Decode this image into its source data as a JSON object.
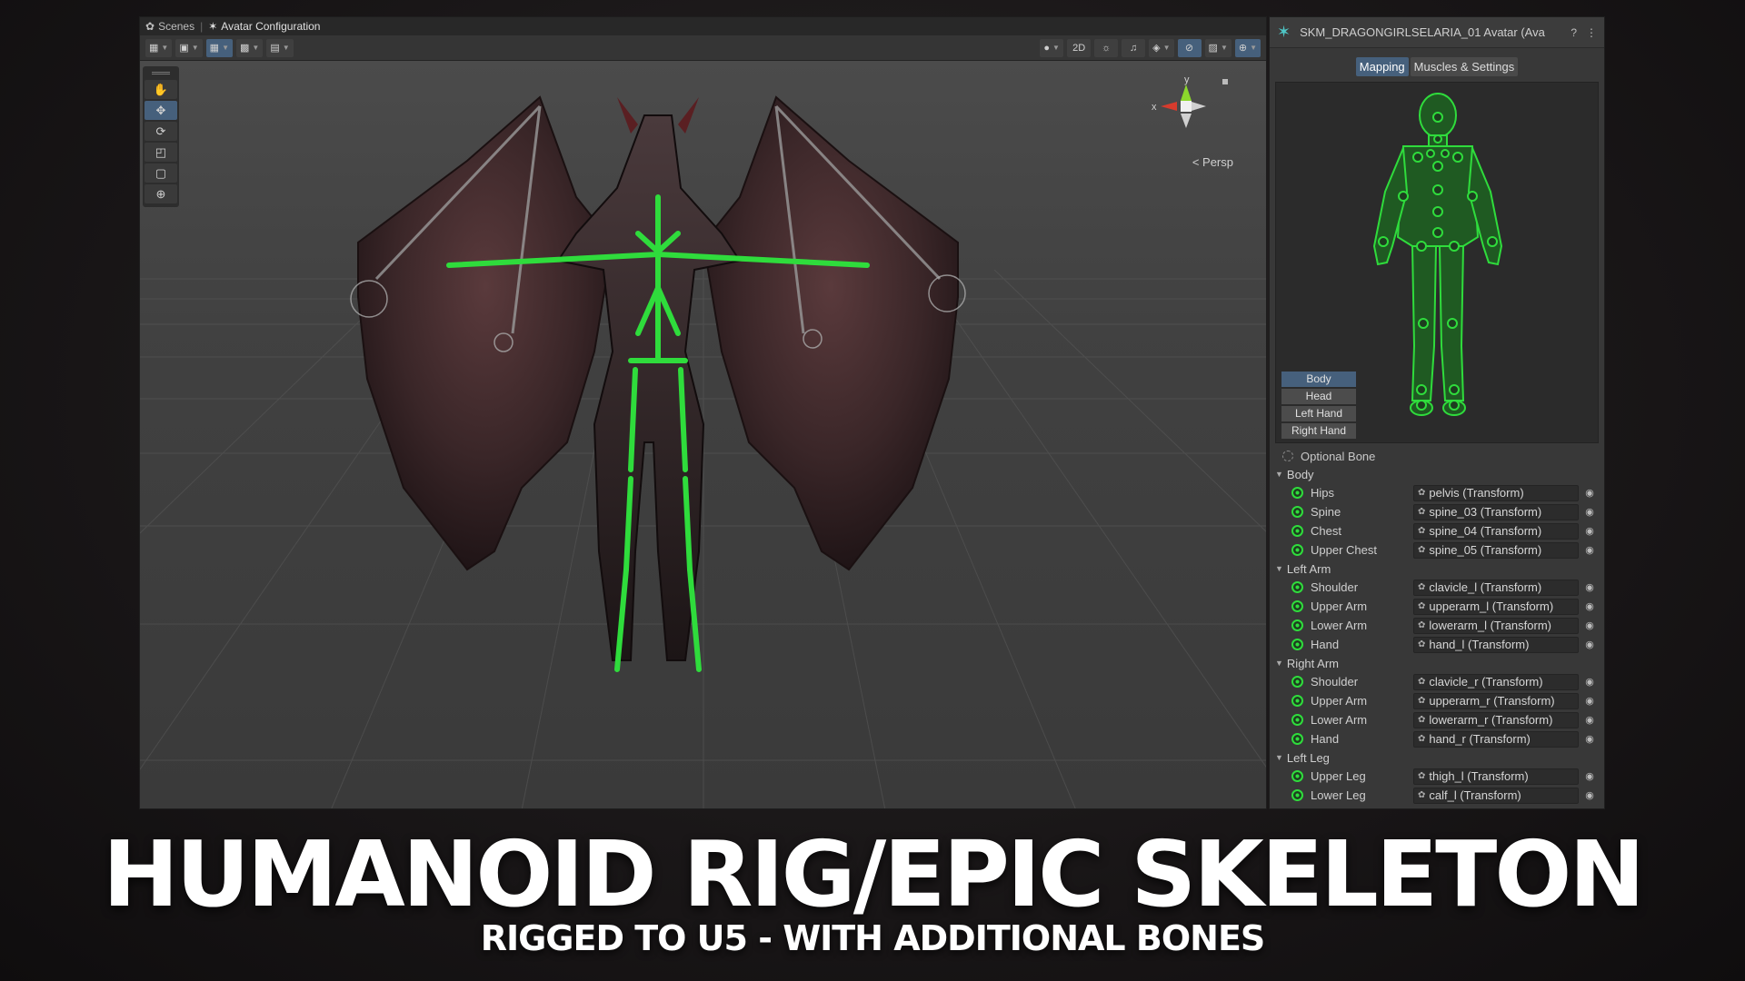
{
  "breadcrumb": [
    {
      "label": "Scenes",
      "icon": "unity-logo-icon"
    },
    {
      "label": "Avatar Configuration",
      "icon": "avatar-icon"
    }
  ],
  "toolbar": {
    "mode_2d_label": "2D"
  },
  "tools": [
    "hand-tool",
    "move-tool",
    "rotate-tool",
    "scale-tool",
    "rect-tool",
    "transform-tool"
  ],
  "gizmo": {
    "y_label": "y",
    "x_label": "x",
    "persp_label": "< Persp"
  },
  "inspector": {
    "title": "SKM_DRAGONGIRLSELARIA_01 Avatar (Ava",
    "tabs": [
      "Mapping",
      "Muscles & Settings"
    ],
    "body_parts": [
      "Body",
      "Head",
      "Left Hand",
      "Right Hand"
    ],
    "optional_bone_label": "Optional Bone",
    "groups": [
      {
        "name": "Body",
        "bones": [
          {
            "name": "Hips",
            "target": "pelvis (Transform)"
          },
          {
            "name": "Spine",
            "target": "spine_03 (Transform)"
          },
          {
            "name": "Chest",
            "target": "spine_04 (Transform)"
          },
          {
            "name": "Upper Chest",
            "target": "spine_05 (Transform)"
          }
        ]
      },
      {
        "name": "Left Arm",
        "bones": [
          {
            "name": "Shoulder",
            "target": "clavicle_l (Transform)"
          },
          {
            "name": "Upper Arm",
            "target": "upperarm_l (Transform)"
          },
          {
            "name": "Lower Arm",
            "target": "lowerarm_l (Transform)"
          },
          {
            "name": "Hand",
            "target": "hand_l (Transform)"
          }
        ]
      },
      {
        "name": "Right Arm",
        "bones": [
          {
            "name": "Shoulder",
            "target": "clavicle_r (Transform)"
          },
          {
            "name": "Upper Arm",
            "target": "upperarm_r (Transform)"
          },
          {
            "name": "Lower Arm",
            "target": "lowerarm_r (Transform)"
          },
          {
            "name": "Hand",
            "target": "hand_r (Transform)"
          }
        ]
      },
      {
        "name": "Left Leg",
        "bones": [
          {
            "name": "Upper Leg",
            "target": "thigh_l (Transform)"
          },
          {
            "name": "Lower Leg",
            "target": "calf_l (Transform)"
          }
        ]
      }
    ]
  },
  "headline": "HUMANOID RIG/EPIC SKELETON",
  "subheadline": "RIGGED TO U5 - WITH ADDITIONAL BONES",
  "colors": {
    "bone_green": "#2fdc3c",
    "active_blue": "#46607c",
    "wing_dark": "#3a2628"
  }
}
